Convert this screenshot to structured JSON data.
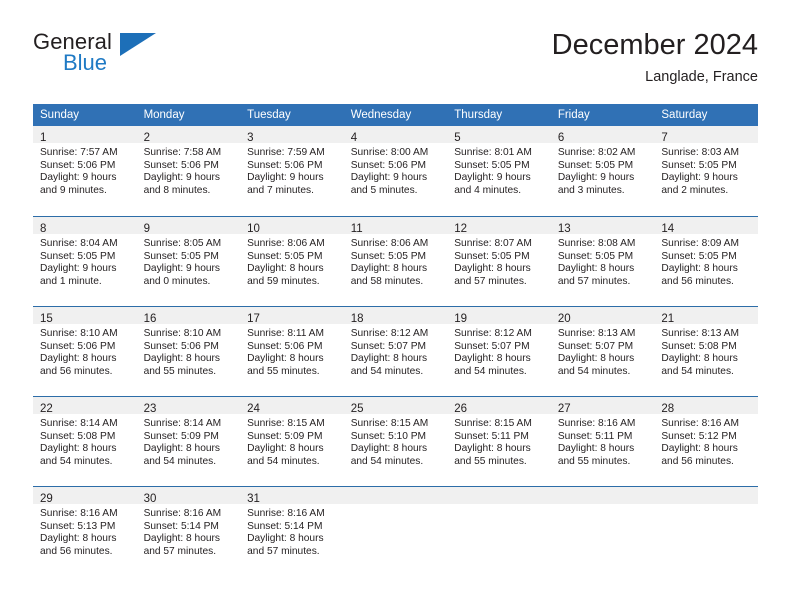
{
  "brand": {
    "name_part1": "General",
    "name_part2": "Blue",
    "accent_color": "#1f7ac4",
    "logo_triangle_color": "#1d6fb8"
  },
  "header": {
    "title": "December 2024",
    "subtitle": "Langlade, France"
  },
  "theme": {
    "header_bg": "#3071b5",
    "daynum_band_bg": "#f0f0f0",
    "week_separator": "#2d6da8",
    "text": "#231f20",
    "page_bg": "#ffffff"
  },
  "calendar": {
    "weekday_headers": [
      "Sunday",
      "Monday",
      "Tuesday",
      "Wednesday",
      "Thursday",
      "Friday",
      "Saturday"
    ],
    "weeks": [
      [
        {
          "day": "1",
          "sunrise": "Sunrise: 7:57 AM",
          "sunset": "Sunset: 5:06 PM",
          "daylight_line1": "Daylight: 9 hours",
          "daylight_line2": "and 9 minutes."
        },
        {
          "day": "2",
          "sunrise": "Sunrise: 7:58 AM",
          "sunset": "Sunset: 5:06 PM",
          "daylight_line1": "Daylight: 9 hours",
          "daylight_line2": "and 8 minutes."
        },
        {
          "day": "3",
          "sunrise": "Sunrise: 7:59 AM",
          "sunset": "Sunset: 5:06 PM",
          "daylight_line1": "Daylight: 9 hours",
          "daylight_line2": "and 7 minutes."
        },
        {
          "day": "4",
          "sunrise": "Sunrise: 8:00 AM",
          "sunset": "Sunset: 5:06 PM",
          "daylight_line1": "Daylight: 9 hours",
          "daylight_line2": "and 5 minutes."
        },
        {
          "day": "5",
          "sunrise": "Sunrise: 8:01 AM",
          "sunset": "Sunset: 5:05 PM",
          "daylight_line1": "Daylight: 9 hours",
          "daylight_line2": "and 4 minutes."
        },
        {
          "day": "6",
          "sunrise": "Sunrise: 8:02 AM",
          "sunset": "Sunset: 5:05 PM",
          "daylight_line1": "Daylight: 9 hours",
          "daylight_line2": "and 3 minutes."
        },
        {
          "day": "7",
          "sunrise": "Sunrise: 8:03 AM",
          "sunset": "Sunset: 5:05 PM",
          "daylight_line1": "Daylight: 9 hours",
          "daylight_line2": "and 2 minutes."
        }
      ],
      [
        {
          "day": "8",
          "sunrise": "Sunrise: 8:04 AM",
          "sunset": "Sunset: 5:05 PM",
          "daylight_line1": "Daylight: 9 hours",
          "daylight_line2": "and 1 minute."
        },
        {
          "day": "9",
          "sunrise": "Sunrise: 8:05 AM",
          "sunset": "Sunset: 5:05 PM",
          "daylight_line1": "Daylight: 9 hours",
          "daylight_line2": "and 0 minutes."
        },
        {
          "day": "10",
          "sunrise": "Sunrise: 8:06 AM",
          "sunset": "Sunset: 5:05 PM",
          "daylight_line1": "Daylight: 8 hours",
          "daylight_line2": "and 59 minutes."
        },
        {
          "day": "11",
          "sunrise": "Sunrise: 8:06 AM",
          "sunset": "Sunset: 5:05 PM",
          "daylight_line1": "Daylight: 8 hours",
          "daylight_line2": "and 58 minutes."
        },
        {
          "day": "12",
          "sunrise": "Sunrise: 8:07 AM",
          "sunset": "Sunset: 5:05 PM",
          "daylight_line1": "Daylight: 8 hours",
          "daylight_line2": "and 57 minutes."
        },
        {
          "day": "13",
          "sunrise": "Sunrise: 8:08 AM",
          "sunset": "Sunset: 5:05 PM",
          "daylight_line1": "Daylight: 8 hours",
          "daylight_line2": "and 57 minutes."
        },
        {
          "day": "14",
          "sunrise": "Sunrise: 8:09 AM",
          "sunset": "Sunset: 5:05 PM",
          "daylight_line1": "Daylight: 8 hours",
          "daylight_line2": "and 56 minutes."
        }
      ],
      [
        {
          "day": "15",
          "sunrise": "Sunrise: 8:10 AM",
          "sunset": "Sunset: 5:06 PM",
          "daylight_line1": "Daylight: 8 hours",
          "daylight_line2": "and 56 minutes."
        },
        {
          "day": "16",
          "sunrise": "Sunrise: 8:10 AM",
          "sunset": "Sunset: 5:06 PM",
          "daylight_line1": "Daylight: 8 hours",
          "daylight_line2": "and 55 minutes."
        },
        {
          "day": "17",
          "sunrise": "Sunrise: 8:11 AM",
          "sunset": "Sunset: 5:06 PM",
          "daylight_line1": "Daylight: 8 hours",
          "daylight_line2": "and 55 minutes."
        },
        {
          "day": "18",
          "sunrise": "Sunrise: 8:12 AM",
          "sunset": "Sunset: 5:07 PM",
          "daylight_line1": "Daylight: 8 hours",
          "daylight_line2": "and 54 minutes."
        },
        {
          "day": "19",
          "sunrise": "Sunrise: 8:12 AM",
          "sunset": "Sunset: 5:07 PM",
          "daylight_line1": "Daylight: 8 hours",
          "daylight_line2": "and 54 minutes."
        },
        {
          "day": "20",
          "sunrise": "Sunrise: 8:13 AM",
          "sunset": "Sunset: 5:07 PM",
          "daylight_line1": "Daylight: 8 hours",
          "daylight_line2": "and 54 minutes."
        },
        {
          "day": "21",
          "sunrise": "Sunrise: 8:13 AM",
          "sunset": "Sunset: 5:08 PM",
          "daylight_line1": "Daylight: 8 hours",
          "daylight_line2": "and 54 minutes."
        }
      ],
      [
        {
          "day": "22",
          "sunrise": "Sunrise: 8:14 AM",
          "sunset": "Sunset: 5:08 PM",
          "daylight_line1": "Daylight: 8 hours",
          "daylight_line2": "and 54 minutes."
        },
        {
          "day": "23",
          "sunrise": "Sunrise: 8:14 AM",
          "sunset": "Sunset: 5:09 PM",
          "daylight_line1": "Daylight: 8 hours",
          "daylight_line2": "and 54 minutes."
        },
        {
          "day": "24",
          "sunrise": "Sunrise: 8:15 AM",
          "sunset": "Sunset: 5:09 PM",
          "daylight_line1": "Daylight: 8 hours",
          "daylight_line2": "and 54 minutes."
        },
        {
          "day": "25",
          "sunrise": "Sunrise: 8:15 AM",
          "sunset": "Sunset: 5:10 PM",
          "daylight_line1": "Daylight: 8 hours",
          "daylight_line2": "and 54 minutes."
        },
        {
          "day": "26",
          "sunrise": "Sunrise: 8:15 AM",
          "sunset": "Sunset: 5:11 PM",
          "daylight_line1": "Daylight: 8 hours",
          "daylight_line2": "and 55 minutes."
        },
        {
          "day": "27",
          "sunrise": "Sunrise: 8:16 AM",
          "sunset": "Sunset: 5:11 PM",
          "daylight_line1": "Daylight: 8 hours",
          "daylight_line2": "and 55 minutes."
        },
        {
          "day": "28",
          "sunrise": "Sunrise: 8:16 AM",
          "sunset": "Sunset: 5:12 PM",
          "daylight_line1": "Daylight: 8 hours",
          "daylight_line2": "and 56 minutes."
        }
      ],
      [
        {
          "day": "29",
          "sunrise": "Sunrise: 8:16 AM",
          "sunset": "Sunset: 5:13 PM",
          "daylight_line1": "Daylight: 8 hours",
          "daylight_line2": "and 56 minutes."
        },
        {
          "day": "30",
          "sunrise": "Sunrise: 8:16 AM",
          "sunset": "Sunset: 5:14 PM",
          "daylight_line1": "Daylight: 8 hours",
          "daylight_line2": "and 57 minutes."
        },
        {
          "day": "31",
          "sunrise": "Sunrise: 8:16 AM",
          "sunset": "Sunset: 5:14 PM",
          "daylight_line1": "Daylight: 8 hours",
          "daylight_line2": "and 57 minutes."
        },
        {
          "day": "",
          "sunrise": "",
          "sunset": "",
          "daylight_line1": "",
          "daylight_line2": ""
        },
        {
          "day": "",
          "sunrise": "",
          "sunset": "",
          "daylight_line1": "",
          "daylight_line2": ""
        },
        {
          "day": "",
          "sunrise": "",
          "sunset": "",
          "daylight_line1": "",
          "daylight_line2": ""
        },
        {
          "day": "",
          "sunrise": "",
          "sunset": "",
          "daylight_line1": "",
          "daylight_line2": ""
        }
      ]
    ]
  }
}
